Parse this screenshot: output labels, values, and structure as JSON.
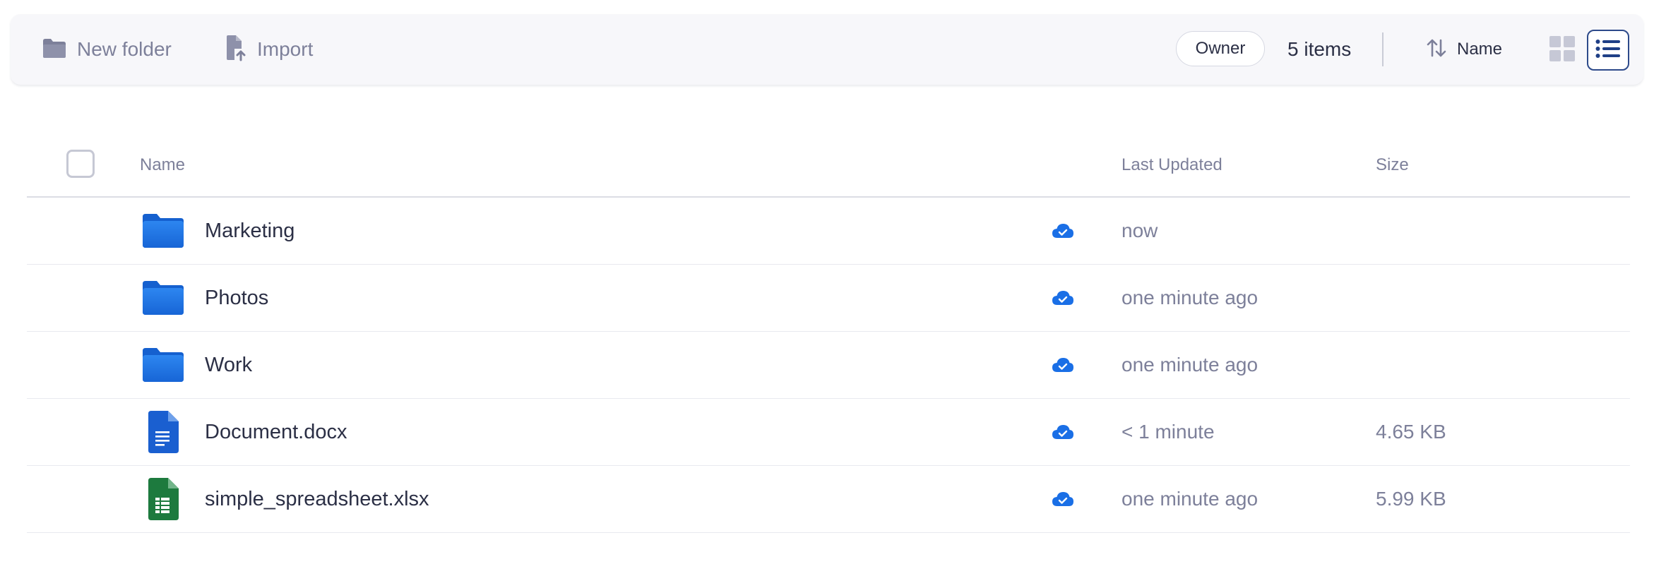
{
  "toolbar": {
    "new_folder_label": "New folder",
    "import_label": "Import",
    "owner_filter": "Owner",
    "item_count": "5 items",
    "sort_label": "Name",
    "view_mode": "list"
  },
  "table": {
    "headers": {
      "name": "Name",
      "last_updated": "Last Updated",
      "size": "Size"
    },
    "rows": [
      {
        "name": "Marketing",
        "type": "folder",
        "icon": "folder-icon",
        "sync": "synced",
        "last_updated": "now",
        "size": ""
      },
      {
        "name": "Photos",
        "type": "folder",
        "icon": "folder-icon",
        "sync": "synced",
        "last_updated": "one minute ago",
        "size": ""
      },
      {
        "name": "Work",
        "type": "folder",
        "icon": "folder-icon",
        "sync": "synced",
        "last_updated": "one minute ago",
        "size": ""
      },
      {
        "name": "Document.docx",
        "type": "document",
        "icon": "document-icon",
        "sync": "synced",
        "last_updated": "< 1 minute",
        "size": "4.65 KB"
      },
      {
        "name": "simple_spreadsheet.xlsx",
        "type": "spreadsheet",
        "icon": "spreadsheet-icon",
        "sync": "synced",
        "last_updated": "one minute ago",
        "size": "5.99 KB"
      }
    ]
  },
  "colors": {
    "accent": "#1a6fe6",
    "folder_blue": "#1e74e8",
    "doc_blue": "#1a5fd0",
    "sheet_green": "#1d7a3e",
    "muted_text": "#7d809a",
    "primary_text": "#2b2f45"
  }
}
